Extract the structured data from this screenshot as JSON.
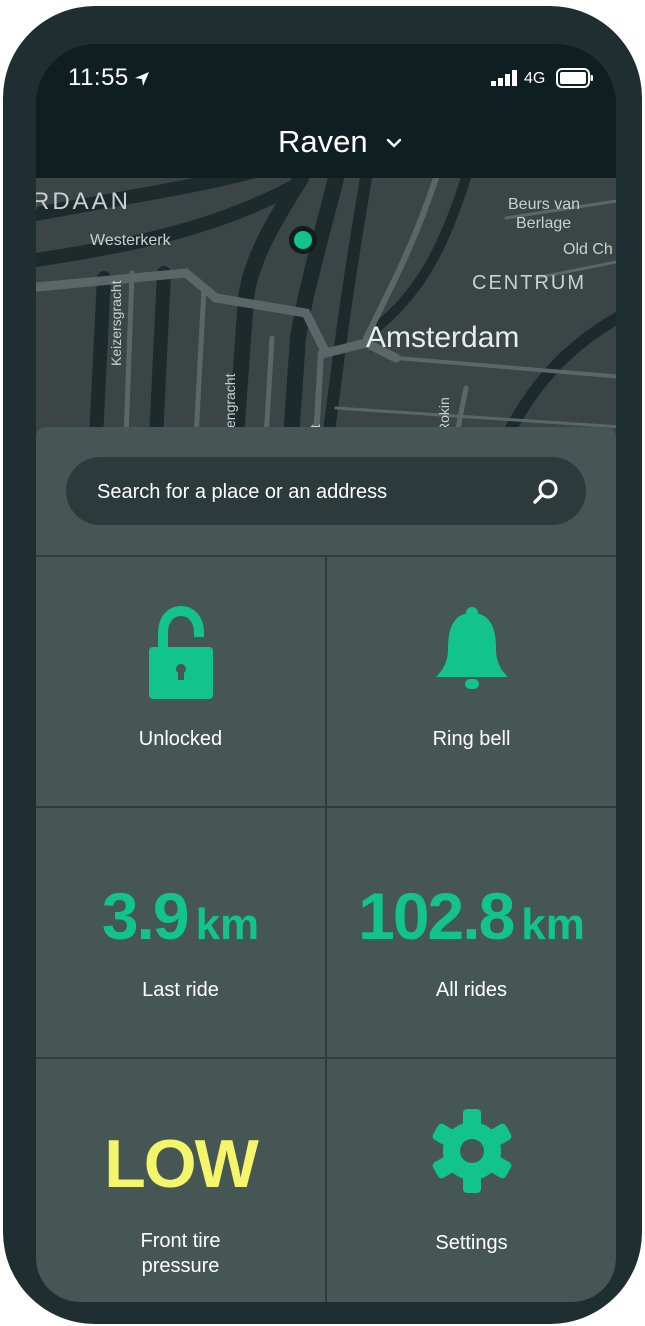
{
  "status_bar": {
    "time": "11:55",
    "network": "4G",
    "icons": [
      "location-arrow-icon",
      "signal-bars-icon",
      "battery-icon"
    ]
  },
  "header": {
    "title": "Raven",
    "icon": "chevron-down-icon"
  },
  "map": {
    "labels": {
      "rdaan": "RDAAN",
      "westerkerk": "Westerkerk",
      "beurs_line1": "Beurs van",
      "beurs_line2": "Berlage",
      "old_ch": "Old Ch",
      "centrum": "CENTRUM",
      "amsterdam": "Amsterdam",
      "keizersgracht": "Keizersgracht",
      "engracht": "engracht",
      "at": "at",
      "rokin": "Rokin"
    },
    "marker_color": "#12c48b"
  },
  "search": {
    "placeholder": "Search for a place or an address",
    "icon": "search-icon"
  },
  "tiles": {
    "lock": {
      "label": "Unlocked",
      "icon": "unlocked-padlock-icon"
    },
    "bell": {
      "label": "Ring bell",
      "icon": "bell-icon"
    },
    "last_ride": {
      "value": "3.9",
      "unit": "km",
      "label": "Last ride"
    },
    "all_rides": {
      "value": "102.8",
      "unit": "km",
      "label": "All rides"
    },
    "tire": {
      "value": "LOW",
      "label_line1": "Front tire",
      "label_line2": "pressure"
    },
    "settings": {
      "label": "Settings",
      "icon": "gear-icon"
    }
  },
  "colors": {
    "accent": "#12c48b",
    "warning": "#f4f56a",
    "panel": "#455654",
    "header": "#0f1e20",
    "device": "#1f2e31"
  }
}
